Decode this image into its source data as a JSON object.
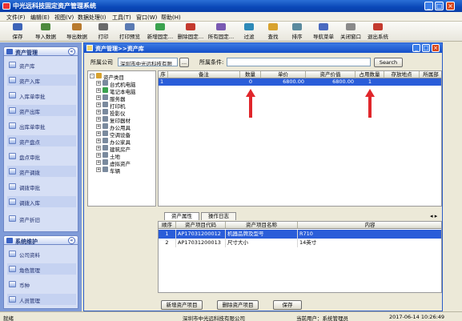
{
  "app": {
    "title": "中光远科技固定资产管理系统"
  },
  "window_controls": {
    "minimize": "_",
    "maximize": "□",
    "close": "×"
  },
  "menu": [
    "文件(F)",
    "编辑(E)",
    "视图(V)",
    "数据处理(I)",
    "工具(T)",
    "窗口(W)",
    "帮助(H)"
  ],
  "toolbar": [
    "保存",
    "导入数据",
    "导出数据",
    "打印",
    "打印预览",
    "新增固定…",
    "删除固定…",
    "所有固定…",
    "过滤",
    "查找",
    "排序",
    "导航菜单",
    "关闭窗口",
    "退出系统"
  ],
  "sidebar": {
    "asset_section": {
      "title": "资产管理",
      "collapse": "«",
      "items": [
        "资产库",
        "资产入库",
        "入库单审批",
        "资产出库",
        "出库单审批",
        "资产盘点",
        "盘点审批",
        "资产调拨",
        "调拨审批",
        "调拨入库",
        "资产折旧"
      ]
    },
    "system_section": {
      "title": "系统维护",
      "collapse": "«",
      "items": [
        "公司资料",
        "角色管理",
        "币种",
        "人员管理"
      ]
    }
  },
  "child_window": {
    "title": "资产管理>>资产库",
    "company_label": "所属公司",
    "company_value": "深圳市中光远科技有限",
    "company_btn": "...",
    "condition_label": "所属条件:",
    "condition_value": "",
    "search_btn": "Search",
    "tree": {
      "root": "资产类目",
      "nodes": [
        "台式机电脑",
        "笔记本电脑",
        "服务器",
        "打印机",
        "投影仪",
        "复印器材",
        "办公用具",
        "空调设备",
        "办公家具",
        "建筑房产",
        "土地",
        "虚拟资产",
        "车辆"
      ]
    },
    "grid": {
      "columns": [
        "序",
        "备注",
        "数量",
        "单价",
        "资产价值",
        "占用数量",
        "存放地点",
        "所属部"
      ],
      "rows": [
        {
          "seq": "1",
          "remark": "",
          "qty": "0",
          "unit_price": "6800.00",
          "value": "6800.00",
          "occupied": "1",
          "location": "",
          "dept": ""
        }
      ]
    },
    "tabs": [
      "资产属性",
      "操作日志"
    ],
    "tab_scroll": "◂ ▸",
    "detail": {
      "columns": [
        "顺序",
        "资产项目代码",
        "资产项目名称",
        "内容"
      ],
      "rows": [
        {
          "seq": "1",
          "code": "AP17031200012",
          "name": "机器品牌及型号",
          "content": "R710"
        },
        {
          "seq": "2",
          "code": "AP17031200013",
          "name": "尺寸大小",
          "content": "14英寸"
        }
      ]
    },
    "buttons": {
      "add": "新增资产项目",
      "delete": "删除资产项目",
      "save": "保存"
    }
  },
  "statusbar": {
    "ready": "就绪",
    "company": "深圳市中光远科技有限公司",
    "user": "当前用户：系统管理员",
    "datetime": "2017-06-14 10:26:49"
  },
  "colors": {
    "titlebar": "#0a48b8",
    "selected_row": "#2a5dd9",
    "sidebar_bg": "#7f9bd8",
    "arrow": "#e0262b"
  }
}
